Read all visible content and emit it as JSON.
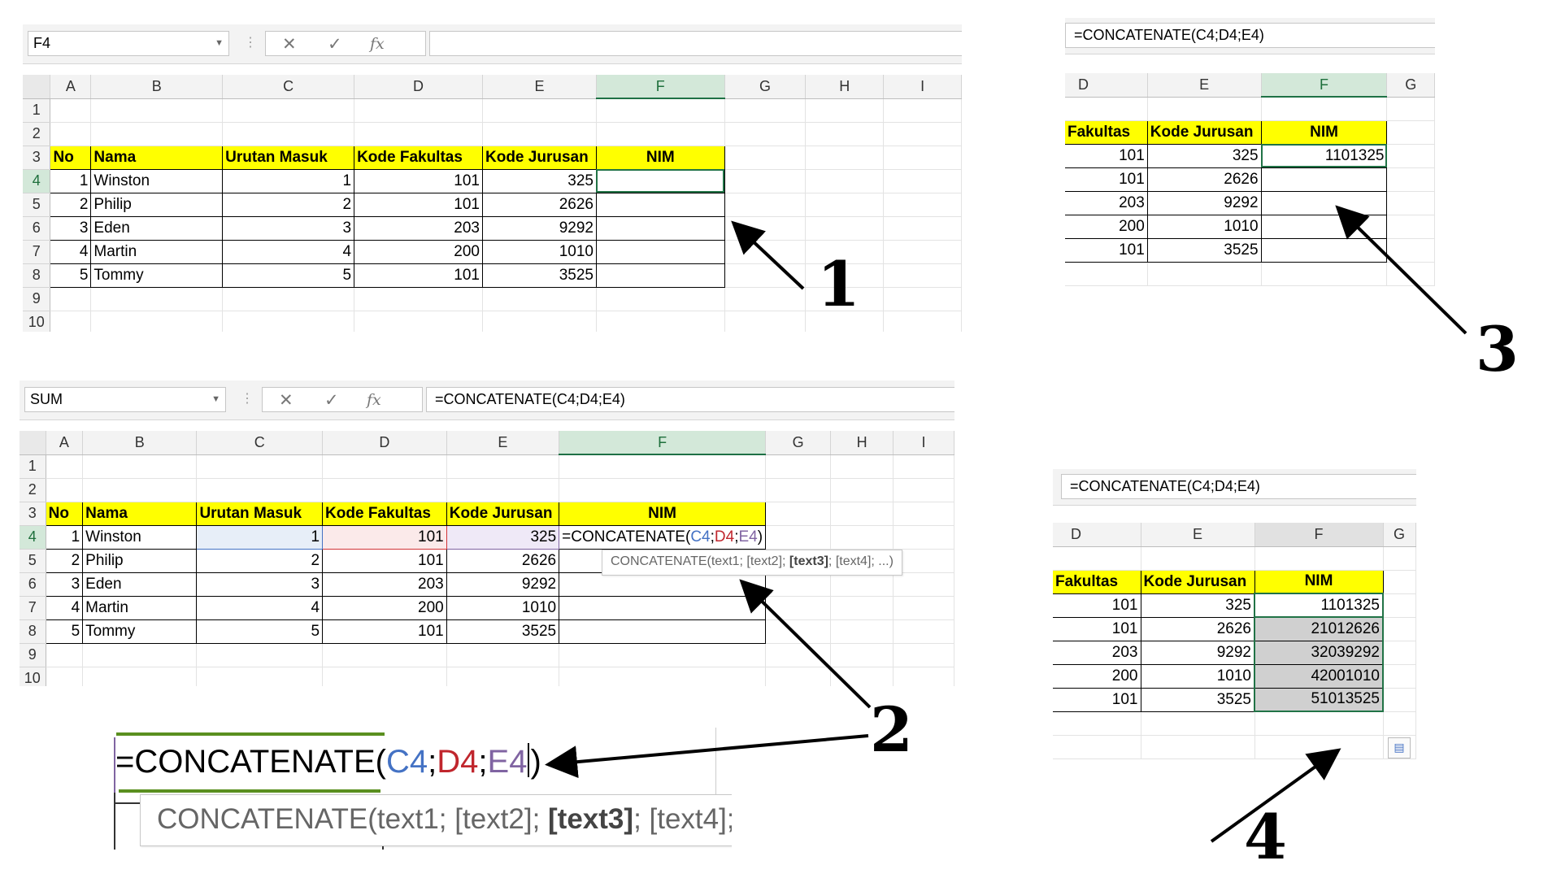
{
  "panel1": {
    "name_box": "F4",
    "formula": "",
    "columns": [
      "A",
      "B",
      "C",
      "D",
      "E",
      "F",
      "G",
      "H",
      "I"
    ],
    "rows": [
      "1",
      "2",
      "3",
      "4",
      "5",
      "6",
      "7",
      "8",
      "9",
      "10"
    ],
    "headers": [
      "No",
      "Nama",
      "Urutan Masuk",
      "Kode Fakultas",
      "Kode Jurusan",
      "NIM"
    ],
    "data": [
      [
        "1",
        "Winston",
        "1",
        "101",
        "325",
        ""
      ],
      [
        "2",
        "Philip",
        "2",
        "101",
        "2626",
        ""
      ],
      [
        "3",
        "Eden",
        "3",
        "203",
        "9292",
        ""
      ],
      [
        "4",
        "Martin",
        "4",
        "200",
        "1010",
        ""
      ],
      [
        "5",
        "Tommy",
        "5",
        "101",
        "3525",
        ""
      ]
    ]
  },
  "panel2": {
    "name_box": "SUM",
    "formula": "=CONCATENATE(C4;D4;E4)",
    "columns": [
      "A",
      "B",
      "C",
      "D",
      "E",
      "F",
      "G",
      "H",
      "I"
    ],
    "rows": [
      "1",
      "2",
      "3",
      "4",
      "5",
      "6",
      "7",
      "8",
      "9",
      "10"
    ],
    "headers": [
      "No",
      "Nama",
      "Urutan Masuk",
      "Kode Fakultas",
      "Kode Jurusan",
      "NIM"
    ],
    "data": [
      [
        "1",
        "Winston",
        "1",
        "101",
        "325",
        ""
      ],
      [
        "2",
        "Philip",
        "2",
        "101",
        "2626",
        ""
      ],
      [
        "3",
        "Eden",
        "3",
        "203",
        "9292",
        ""
      ],
      [
        "4",
        "Martin",
        "4",
        "200",
        "1010",
        ""
      ],
      [
        "5",
        "Tommy",
        "5",
        "101",
        "3525",
        ""
      ]
    ],
    "edit": {
      "prefix": "=CONCATENATE(",
      "c4": "C4",
      "sep": ";",
      "d4": "D4",
      "e4": "E4",
      "suffix": ")"
    },
    "tooltip": {
      "pre": "CONCATENATE(text1; [text2]; ",
      "bold": "[text3]",
      "post": "; [text4]; ...)"
    }
  },
  "panel3": {
    "formula": "=CONCATENATE(C4;D4;E4)",
    "columns": [
      "D",
      "E",
      "F",
      "G"
    ],
    "headers": [
      "Fakultas",
      "Kode Jurusan",
      "NIM"
    ],
    "data": [
      [
        "101",
        "325",
        "1101325"
      ],
      [
        "101",
        "2626",
        ""
      ],
      [
        "203",
        "9292",
        ""
      ],
      [
        "200",
        "1010",
        ""
      ],
      [
        "101",
        "3525",
        ""
      ]
    ]
  },
  "panel4": {
    "formula": "=CONCATENATE(C4;D4;E4)",
    "columns": [
      "D",
      "E",
      "F",
      "G"
    ],
    "headers": [
      "Fakultas",
      "Kode Jurusan",
      "NIM"
    ],
    "data": [
      [
        "101",
        "325",
        "1101325"
      ],
      [
        "101",
        "2626",
        "21012626"
      ],
      [
        "203",
        "9292",
        "32039292"
      ],
      [
        "200",
        "1010",
        "42001010"
      ],
      [
        "101",
        "3525",
        "51013525"
      ]
    ]
  },
  "callouts": {
    "one": "1",
    "two": "2",
    "three": "3",
    "four": "4"
  },
  "colors": {
    "header_fill": "#ffff00",
    "selection_green": "#217346",
    "ref_blue": "#4472c4",
    "ref_red": "#d13438",
    "ref_purple": "#8064a2"
  },
  "icons": [
    "cancel-icon",
    "enter-icon",
    "fx-icon",
    "dropdown-icon",
    "autofill-options-icon"
  ]
}
